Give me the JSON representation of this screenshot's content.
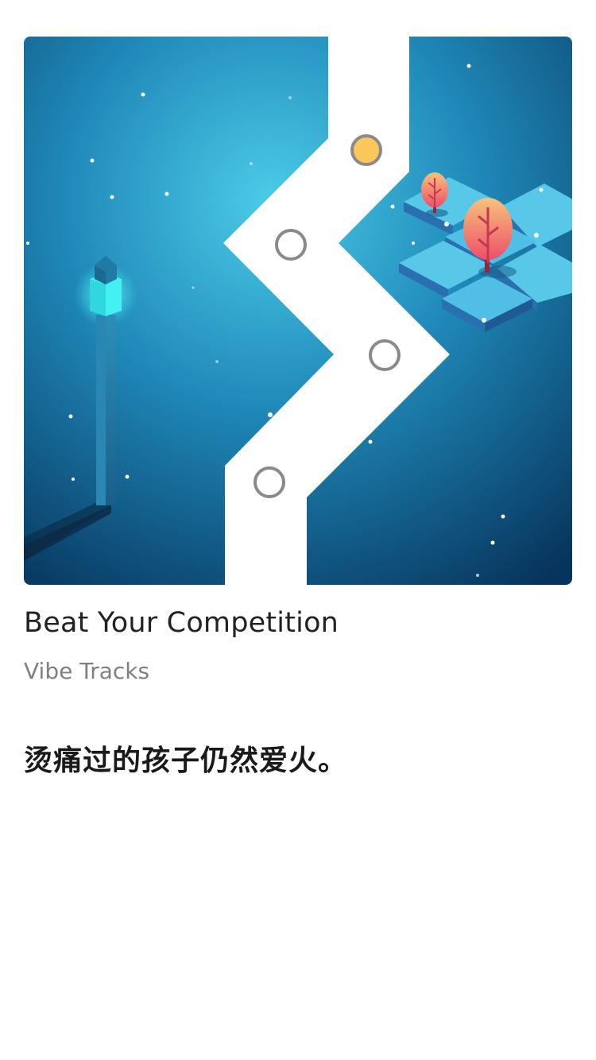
{
  "article": {
    "title": "Beat Your Competition",
    "author": "Vibe Tracks",
    "quote": "烫痛过的孩子仍然爱火。"
  },
  "artwork": {
    "icons": [
      "glowing-pillar-icon",
      "zigzag-path",
      "gold-ball-icon",
      "ring-marker-icon",
      "floating-tiles-icon",
      "tree-icon"
    ],
    "colors": {
      "background_center": "#48c6e6",
      "background_edge": "#0a3a63",
      "path": "#ffffff",
      "ball": "#f9c75a",
      "ring": "#8a8a8a",
      "tile_top": "#57c9ea",
      "tile_side": "#2a6fb0",
      "tree_top": "#f6b07a",
      "tree_bottom": "#f0566a",
      "pillar_glow": "#3ef2f2"
    }
  }
}
